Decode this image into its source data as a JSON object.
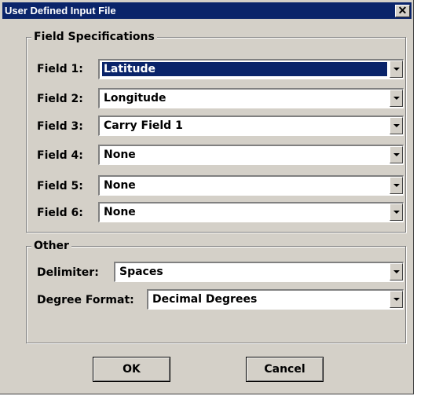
{
  "window": {
    "title": "User Defined Input File",
    "close_glyph": "✕"
  },
  "field_specifications": {
    "label": "Field Specifications",
    "fields": [
      {
        "label": "Field 1:",
        "value": "Latitude"
      },
      {
        "label": "Field 2:",
        "value": "Longitude"
      },
      {
        "label": "Field 3:",
        "value": "Carry Field 1"
      },
      {
        "label": "Field 4:",
        "value": "None"
      },
      {
        "label": "Field 5:",
        "value": "None"
      },
      {
        "label": "Field 6:",
        "value": "None"
      }
    ]
  },
  "other": {
    "label": "Other",
    "delimiter_label": "Delimiter:",
    "delimiter_value": "Spaces",
    "degree_format_label": "Degree Format:",
    "degree_format_value": "Decimal Degrees"
  },
  "buttons": {
    "ok": "OK",
    "cancel": "Cancel"
  },
  "colors": {
    "titlebar": "#0a246a",
    "face": "#d4d0c8",
    "selection": "#0a246a"
  },
  "icons": {
    "close": "close-icon",
    "dropdown": "chevron-down-icon"
  }
}
